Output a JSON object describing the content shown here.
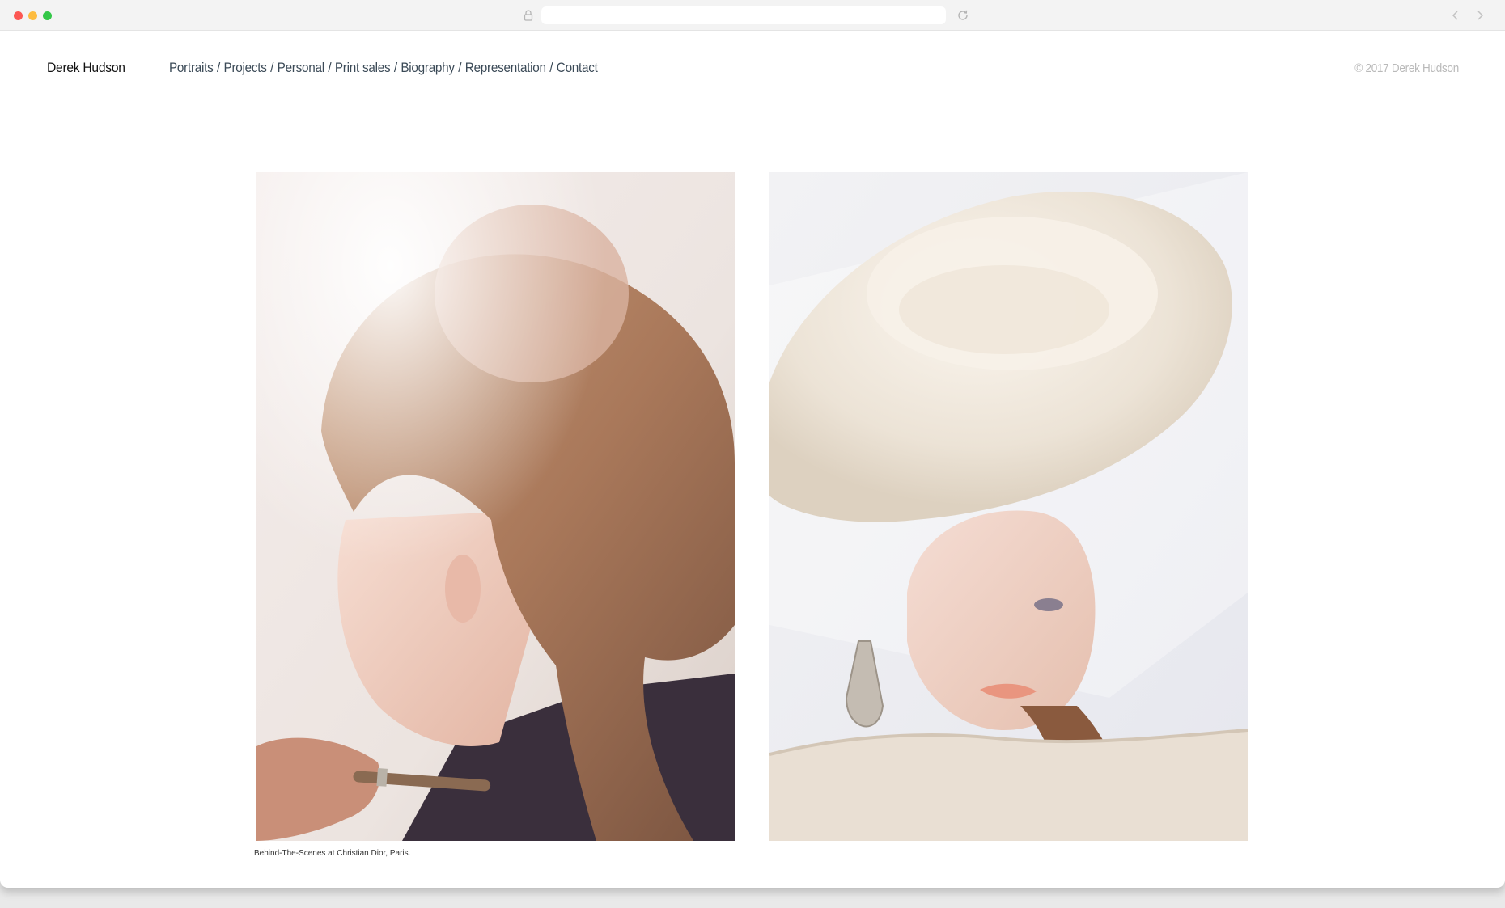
{
  "browser": {
    "icons": [
      "lock-icon",
      "reload-icon",
      "back-icon",
      "forward-icon"
    ]
  },
  "site": {
    "name": "Derek Hudson",
    "copyright": "© 2017 Derek Hudson"
  },
  "nav": {
    "items": [
      {
        "label": "Portraits"
      },
      {
        "label": "Projects"
      },
      {
        "label": "Personal"
      },
      {
        "label": "Print sales"
      },
      {
        "label": "Biography"
      },
      {
        "label": "Representation"
      },
      {
        "label": "Contact"
      }
    ],
    "separator": "/"
  },
  "gallery": {
    "caption": "Behind-The-Scenes at Christian Dior, Paris."
  },
  "colors": {
    "nav_text": "#3b4a57",
    "copyright_text": "#b9b9b9",
    "page_background": "#ffffff"
  }
}
